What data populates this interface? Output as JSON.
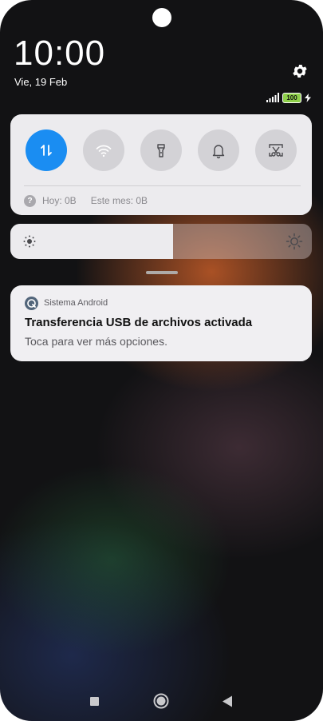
{
  "status_bar": {
    "time": "10:00",
    "date": "Vie, 19 Feb",
    "battery_level": "100"
  },
  "quick_settings": {
    "tiles": [
      {
        "name": "mobile-data",
        "icon": "data-transfer-icon",
        "active": true
      },
      {
        "name": "wifi",
        "icon": "wifi-icon",
        "active": false
      },
      {
        "name": "flashlight",
        "icon": "flashlight-icon",
        "active": false
      },
      {
        "name": "sound",
        "icon": "bell-icon",
        "active": false
      },
      {
        "name": "screenshot",
        "icon": "scissors-icon",
        "active": false
      }
    ],
    "data_today": "Hoy: 0B",
    "data_month": "Este mes: 0B"
  },
  "brightness": {
    "level": 0.54
  },
  "notification": {
    "app_name": "Sistema Android",
    "title": "Transferencia USB de archivos activada",
    "body": "Toca para ver más opciones."
  },
  "navigation": {
    "buttons": [
      "recents",
      "home",
      "back"
    ]
  },
  "colors": {
    "accent": "#1a8df2",
    "battery": "#8ed04a",
    "panel": "#ecebee"
  }
}
